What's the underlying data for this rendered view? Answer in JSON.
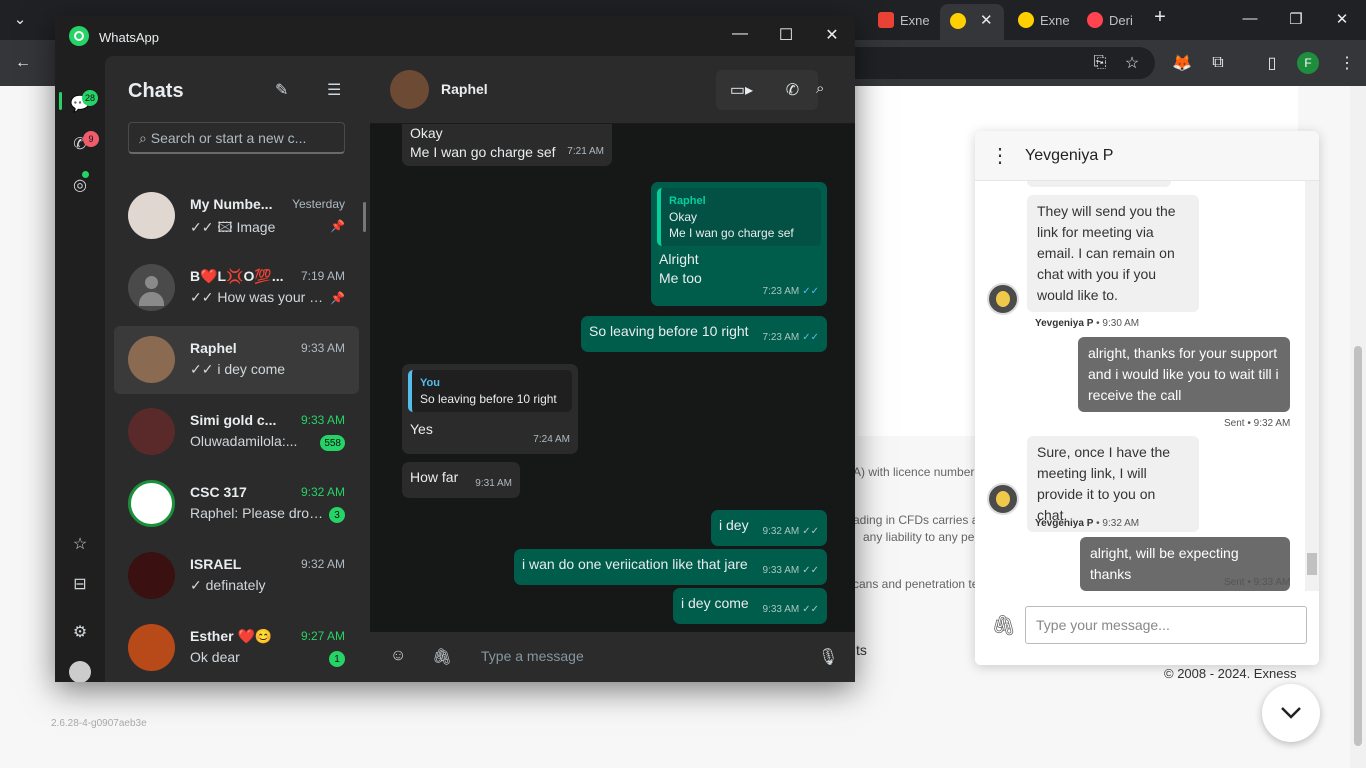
{
  "browser": {
    "tabs": [
      {
        "label": "Exne",
        "color": "#ea4335"
      },
      {
        "label": "",
        "color": "#ffcf00"
      },
      {
        "label": "Exne",
        "color": "#ffcf00"
      },
      {
        "label": "Deri",
        "color": "#ff444f"
      }
    ],
    "new_tab": "+",
    "profile_initial": "F"
  },
  "page": {
    "text_licence": "A) with licence number",
    "text_cfds": "ading in CFDs carries a",
    "text_liability": "any liability to any pe",
    "text_penetration": "cans and penetration te",
    "text_ts": "ts",
    "footer": "© 2008 - 2024. Exness",
    "version": "2.6.28-4-g0907aeb3e"
  },
  "livechat": {
    "agent": "Yevgeniya P",
    "messages": [
      {
        "dir": "in",
        "text": "They will send you the link for meeting via email. I can remain on chat with you if you would like to.",
        "meta_name": "Yevgeniya P",
        "meta_time": " • 9:30 AM"
      },
      {
        "dir": "out",
        "text": "alright, thanks for your support and i would like you to wait till i receive the call",
        "meta": "Sent • 9:32 AM"
      },
      {
        "dir": "in",
        "text": "Sure, once I have the meeting link, I will provide it to you on chat.",
        "meta_name": "Yevgeniya P",
        "meta_time": " • 9:32 AM"
      },
      {
        "dir": "out",
        "text": "alright, will be expecting thanks",
        "meta": "Sent • 9:33 AM"
      }
    ],
    "input_placeholder": "Type your message..."
  },
  "whatsapp": {
    "app_title": "WhatsApp",
    "rail": {
      "chats_badge": "28",
      "calls_badge": "9"
    },
    "list_title": "Chats",
    "search_placeholder": "Search or start a new c...",
    "chats": [
      {
        "name": "My Numbe...",
        "time": "Yesterday",
        "preview": "✓✓ 🖾 Image",
        "pinned": true
      },
      {
        "name": "B❤️L💢O💯...",
        "time": "7:19 AM",
        "preview": "✓✓ How was your ni...",
        "pinned": true
      },
      {
        "name": "Raphel",
        "time": "9:33 AM",
        "preview": "✓✓ i dey come"
      },
      {
        "name": "Simi gold c...",
        "time": "9:33 AM",
        "preview": "Oluwadamilola:...",
        "badge": "558"
      },
      {
        "name": "CSC 317",
        "time": "9:32 AM",
        "preview": "Raphel: Please drop...",
        "badge": "3"
      },
      {
        "name": "ISRAEL",
        "time": "9:32 AM",
        "preview": "✓ definately"
      },
      {
        "name": "Esther ❤️😊",
        "time": "9:27 AM",
        "preview": "Ok dear",
        "badge": "1"
      }
    ],
    "conversation": {
      "contact": "Raphel",
      "msg1_line1": "Okay",
      "msg1_line2": "Me I wan go charge sef",
      "msg1_time": "7:21 AM",
      "msg2_quote_author": "Raphel",
      "msg2_quote_line1": "Okay",
      "msg2_quote_line2": "Me I wan go charge sef",
      "msg2_line1": "Alright",
      "msg2_line2": "Me too",
      "msg2_time": "7:23 AM",
      "msg3_text": "So leaving before 10 right",
      "msg3_time": "7:23 AM",
      "msg4_quote_author": "You",
      "msg4_quote_text": "So leaving before 10 right",
      "msg4_text": "Yes",
      "msg4_time": "7:24 AM",
      "msg5_text": "How far",
      "msg5_time": "9:31 AM",
      "msg6_text": "i dey",
      "msg6_time": "9:32 AM",
      "msg7_text": "i wan do one veriication like that jare",
      "msg7_time": "9:33 AM",
      "msg8_text": "i dey come",
      "msg8_time": "9:33 AM",
      "input_placeholder": "Type a message"
    }
  }
}
